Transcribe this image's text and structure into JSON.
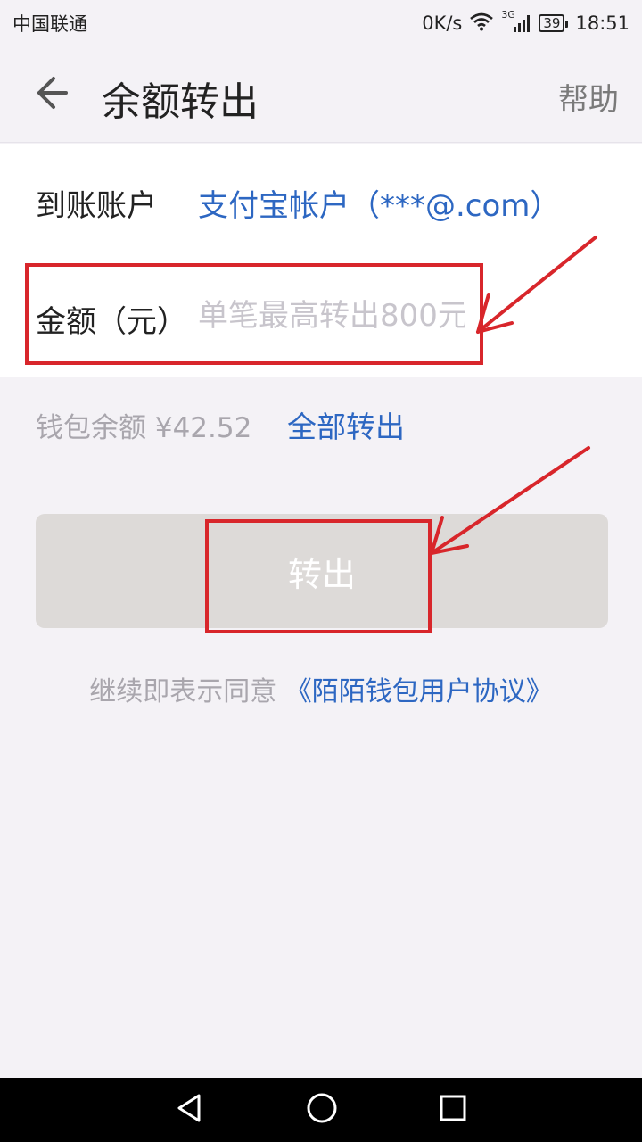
{
  "status_bar": {
    "carrier": "中国联通",
    "network_speed": "0K/s",
    "signal_type": "3G",
    "battery": "39",
    "time": "18:51"
  },
  "header": {
    "title": "余额转出",
    "help_label": "帮助"
  },
  "form": {
    "account_label": "到账账户",
    "account_value": "支付宝帐户（***@.com）",
    "amount_label": "金额（元）",
    "amount_placeholder": "单笔最高转出800元",
    "amount_value": ""
  },
  "wallet": {
    "balance_text": "钱包余额 ¥42.52",
    "transfer_all_label": "全部转出"
  },
  "submit_label": "转出",
  "agreement": {
    "prefix": "继续即表示同意 ",
    "link": "《陌陌钱包用户协议》"
  },
  "colors": {
    "accent": "#2d67c2",
    "annotation": "#d8262b",
    "button_disabled": "#dddad8"
  }
}
